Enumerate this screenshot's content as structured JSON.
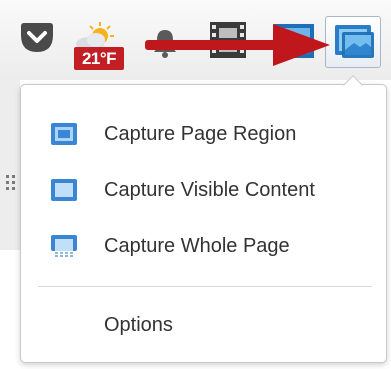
{
  "toolbar": {
    "weather_temp": "21°F",
    "icons": [
      "pocket-icon",
      "weather-icon",
      "bell-icon",
      "film-icon",
      "screenshot-icon",
      "capture-icon"
    ]
  },
  "menu": {
    "items": [
      {
        "label": "Capture Page Region",
        "icon": "page-region-icon"
      },
      {
        "label": "Capture Visible Content",
        "icon": "visible-content-icon"
      },
      {
        "label": "Capture Whole Page",
        "icon": "whole-page-icon"
      }
    ],
    "options_label": "Options"
  },
  "colors": {
    "arrow": "#c0171d",
    "badge": "#c21f24",
    "icon_blue": "#3d8fd9",
    "text": "#333333"
  }
}
